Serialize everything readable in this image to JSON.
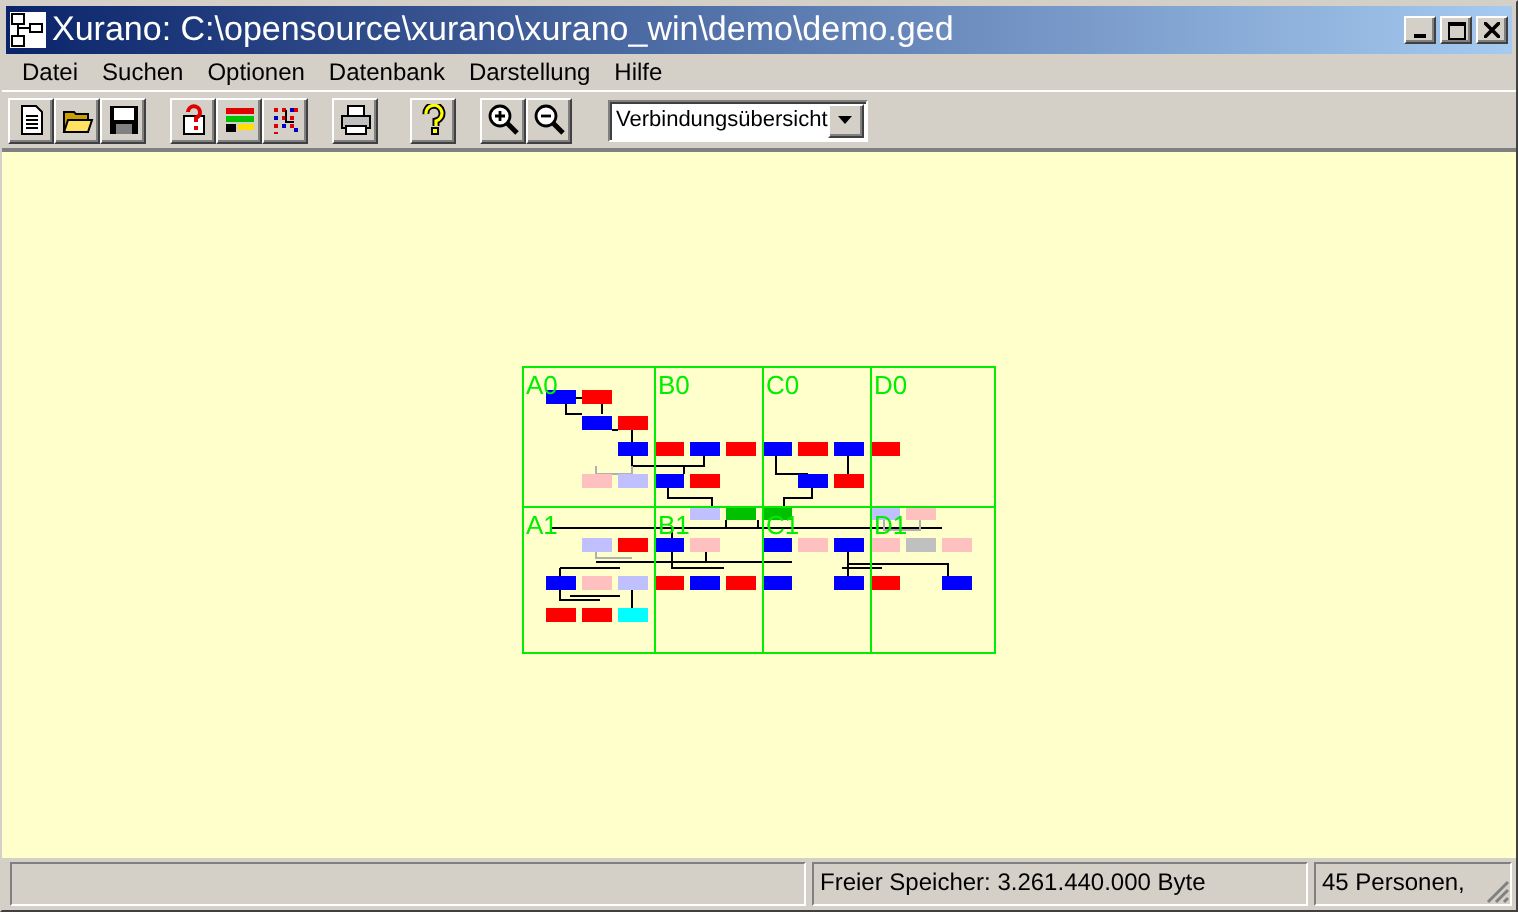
{
  "window": {
    "title": "Xurano: C:\\opensource\\xurano\\xurano_win\\demo\\demo.ged"
  },
  "menu": [
    "Datei",
    "Suchen",
    "Optionen",
    "Datenbank",
    "Darstellung",
    "Hilfe"
  ],
  "toolbar": [
    [
      {
        "kind": "new"
      },
      {
        "kind": "open"
      },
      {
        "kind": "save"
      }
    ],
    [
      {
        "kind": "person-help"
      },
      {
        "kind": "grid"
      },
      {
        "kind": "dots"
      }
    ],
    [
      {
        "kind": "print"
      }
    ],
    [
      {
        "kind": "help"
      }
    ],
    [
      {
        "kind": "zoom-in"
      },
      {
        "kind": "zoom-out"
      }
    ]
  ],
  "view_select": {
    "value": "Verbindungsübersicht"
  },
  "diagram": {
    "grid_labels": [
      [
        "A0",
        "B0",
        "C0",
        "D0"
      ],
      [
        "A1",
        "B1",
        "C1",
        "D1"
      ]
    ]
  },
  "status_bar": [
    "Freier Speicher: 3.261.440.000 Byte",
    "45 Personen,"
  ]
}
